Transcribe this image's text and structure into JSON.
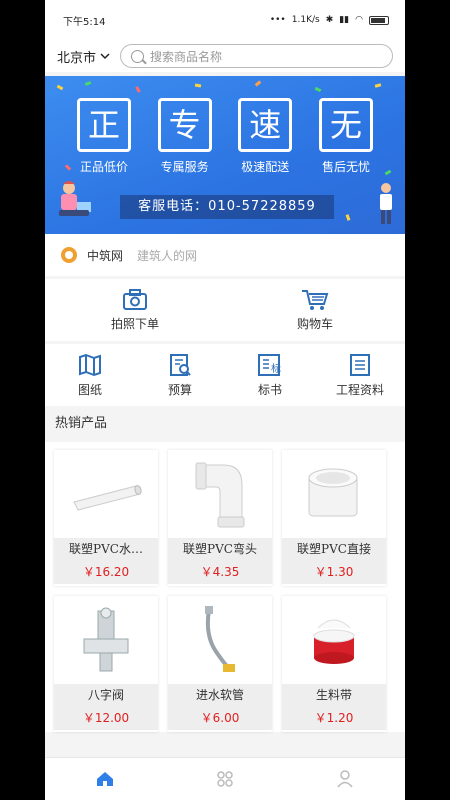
{
  "status": {
    "time": "下午5:14",
    "speed": "1.1K/s"
  },
  "header": {
    "city": "北京市",
    "search_placeholder": "搜索商品名称"
  },
  "banner": {
    "promises": [
      {
        "char": "正",
        "label": "正品低价"
      },
      {
        "char": "专",
        "label": "专属服务"
      },
      {
        "char": "速",
        "label": "极速配送"
      },
      {
        "char": "无",
        "label": "售后无忧"
      }
    ],
    "hotline": "客服电话：010-57228859"
  },
  "brand": {
    "name": "中筑网",
    "slogan": "建筑人的网"
  },
  "quick_actions": [
    {
      "label": "拍照下单",
      "icon": "camera-icon"
    },
    {
      "label": "购物车",
      "icon": "cart-icon"
    }
  ],
  "categories": [
    {
      "label": "图纸",
      "icon": "map-icon"
    },
    {
      "label": "预算",
      "icon": "budget-icon"
    },
    {
      "label": "标书",
      "icon": "bid-icon"
    },
    {
      "label": "工程资料",
      "icon": "document-icon"
    }
  ],
  "hot": {
    "title": "热销产品",
    "products": [
      {
        "name": "联塑PVC水…",
        "price": "￥16.20",
        "icon": "pvc-pipe-icon"
      },
      {
        "name": "联塑PVC弯头",
        "price": "￥4.35",
        "icon": "elbow-icon"
      },
      {
        "name": "联塑PVC直接",
        "price": "￥1.30",
        "icon": "coupling-icon"
      },
      {
        "name": "八字阀",
        "price": "￥12.00",
        "icon": "valve-icon"
      },
      {
        "name": "进水软管",
        "price": "￥6.00",
        "icon": "hose-icon"
      },
      {
        "name": "生料带",
        "price": "￥1.20",
        "icon": "tape-icon"
      }
    ]
  },
  "colors": {
    "brand_blue": "#2f7fe8",
    "price_red": "#e02020",
    "icon_blue": "#2f6fb8"
  },
  "tabs": [
    {
      "icon": "home-icon",
      "active": true
    },
    {
      "icon": "grid-icon",
      "active": false
    },
    {
      "icon": "user-icon",
      "active": false
    }
  ]
}
